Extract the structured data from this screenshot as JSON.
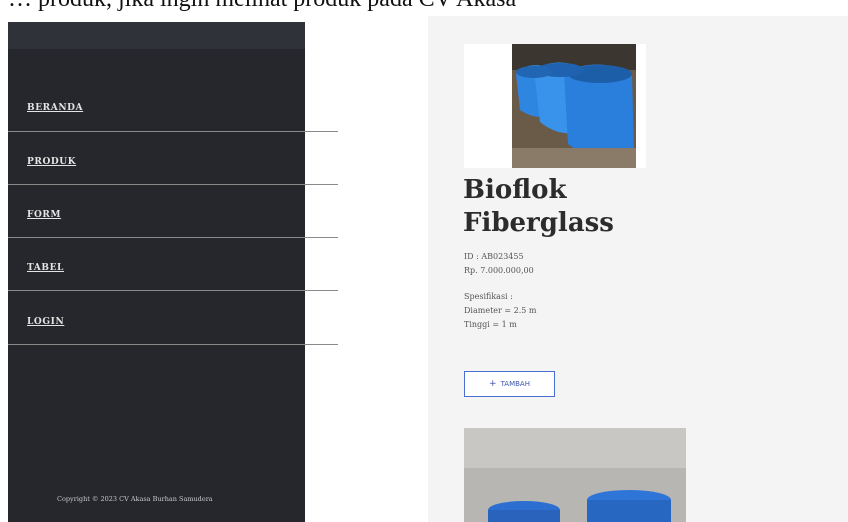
{
  "caption": "… produk, jika ingin melihat produk pada CV Akasa",
  "sidebar": {
    "items": [
      {
        "label": "BERANDA"
      },
      {
        "label": "PRODUK"
      },
      {
        "label": "FORM"
      },
      {
        "label": "TABEL"
      },
      {
        "label": "LOGIN"
      }
    ],
    "footer": "Copyright © 2023 CV Akasa Burhan Samudera"
  },
  "product": {
    "title": "Bioflok Fiberglass",
    "id_text": "ID : AB023455",
    "price": "Rp. 7.000.000,00",
    "spec_heading": "Spesifikasi :",
    "spec_diameter": "Diameter = 2.5 m",
    "spec_height": "Tinggi = 1 m",
    "add_label": "TAMBAH",
    "add_icon": "plus-icon"
  },
  "colors": {
    "sidebar_bg": "#25272d",
    "accent": "#4a6fd1",
    "tank_blue": "#2f86e0"
  }
}
